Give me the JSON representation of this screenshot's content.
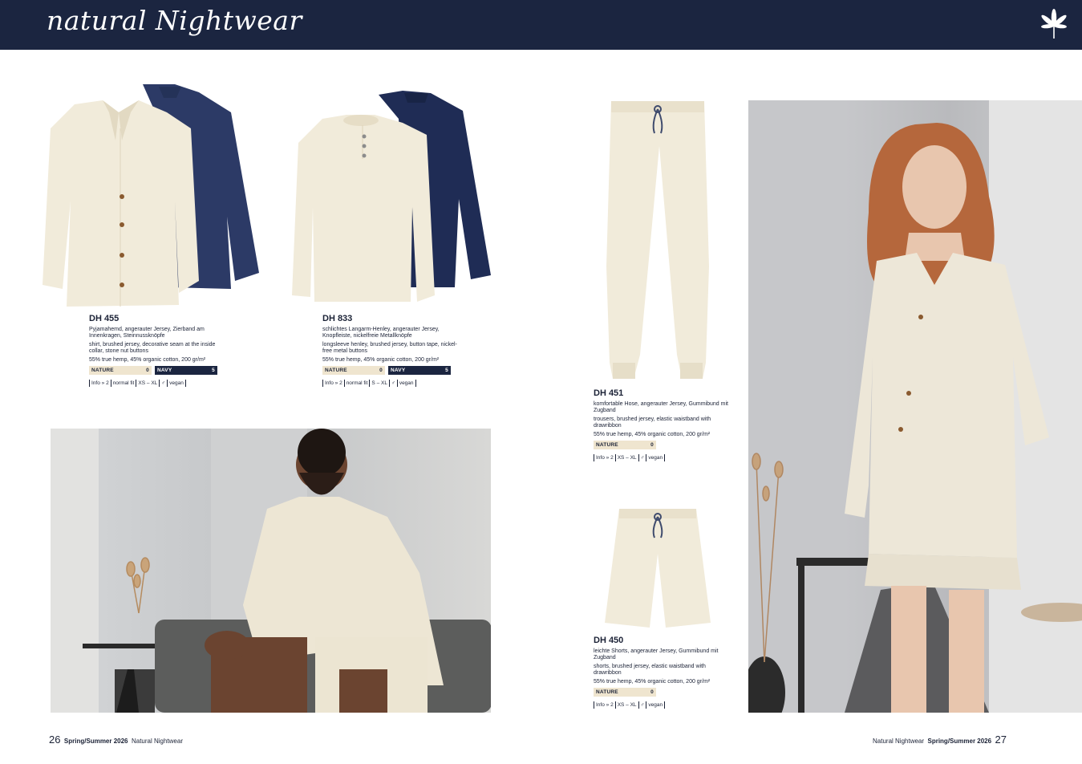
{
  "header": {
    "title": "natural Nightwear",
    "logo_icon": "hemp-leaf-icon",
    "background": "#1b2540"
  },
  "products": [
    {
      "code": "DH 455",
      "desc_de": "Pyjamahemd, angerauter Jersey, Zierband am Innenkragen, Steinnussknöpfe",
      "desc_en": "shirt, brushed jersey, decorative seam at the inside collar, stone nut buttons",
      "material": "55% true hemp, 45% organic cotton, 200 gr/m²",
      "colors": [
        {
          "name": "NATURE",
          "value": "0"
        },
        {
          "name": "NAVY",
          "value": "5"
        }
      ],
      "info": [
        "Info » 2",
        "normal fit",
        "XS – XL",
        "♂",
        "vegan"
      ]
    },
    {
      "code": "DH 833",
      "desc_de": "schlichtes Langarm-Henley, angerauter Jersey, Knopfleiste, nickelfreie Metallknöpfe",
      "desc_en": "longsleeve henley, brushed jersey, button tape, nickel-free metal buttons",
      "material": "55% true hemp, 45% organic cotton, 200 gr/m²",
      "colors": [
        {
          "name": "NATURE",
          "value": "0"
        },
        {
          "name": "NAVY",
          "value": "5"
        }
      ],
      "info": [
        "Info » 2",
        "normal fit",
        "S – XL",
        "♂",
        "vegan"
      ]
    },
    {
      "code": "DH 451",
      "desc_de": "komfortable Hose, angerauter Jersey, Gummibund mit Zugband",
      "desc_en": "trousers, brushed jersey, elastic waistband with drawribbon",
      "material": "55% true hemp, 45% organic cotton, 200 gr/m²",
      "colors": [
        {
          "name": "NATURE",
          "value": "0"
        }
      ],
      "info": [
        "Info » 2",
        "XS – XL",
        "♂",
        "vegan"
      ]
    },
    {
      "code": "DH 450",
      "desc_de": "leichte Shorts, angerauter Jersey, Gummibund mit Zugband",
      "desc_en": "shorts, brushed jersey, elastic waistband with drawribbon",
      "material": "55% true hemp, 45% organic cotton, 200 gr/m²",
      "colors": [
        {
          "name": "NATURE",
          "value": "0"
        }
      ],
      "info": [
        "Info » 2",
        "XS – XL",
        "♂",
        "vegan"
      ]
    }
  ],
  "footer": {
    "left_page": "26",
    "left_season": "Spring/Summer 2026",
    "left_section": "Natural Nightwear",
    "right_section": "Natural Nightwear",
    "right_season": "Spring/Summer 2026",
    "right_page": "27"
  },
  "colors": {
    "navy": "#1b2540",
    "nature": "#efe5cf"
  }
}
